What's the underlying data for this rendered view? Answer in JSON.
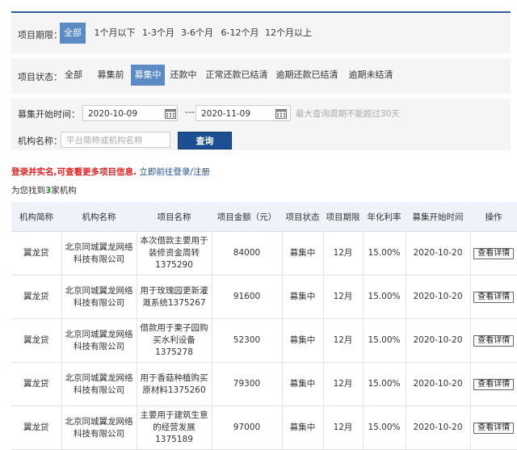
{
  "filters": {
    "term": {
      "label": "项目期限：",
      "options": [
        "全部",
        "1个月以下",
        "1-3个月",
        "3-6个月",
        "6-12个月",
        "12个月以上"
      ],
      "active_index": 0
    },
    "status": {
      "label": "项目状态：",
      "options": [
        "全部",
        "募集前",
        "募集中",
        "还款中",
        "正常还款已结清",
        "逾期还款已结清",
        "逾期未结清"
      ],
      "active_index": 2
    },
    "date": {
      "label": "募集开始时间：",
      "start": "2020-10-09",
      "separator": "---",
      "end": "2020-11-09",
      "hint": "最大查询周期不能超过30天"
    },
    "org": {
      "label": "机构名称：",
      "placeholder": "平台简称或机构名称",
      "query_label": "查询"
    }
  },
  "notice": {
    "warning": "登录并实名,可查看更多项目信息.",
    "link": "立即前往登录/注册"
  },
  "found": {
    "prefix": "为您找到",
    "count": "3",
    "suffix": "家机构"
  },
  "table": {
    "headers": [
      "机构简称",
      "机构名称",
      "项目名称",
      "项目金额（元）",
      "项目状态",
      "项目期限",
      "年化利率",
      "募集开始时间",
      "操作"
    ],
    "rows": [
      {
        "short": "翼龙贷",
        "org": "北京同城翼龙网络科技有限公司",
        "project": "本次借款主要用于装修资金周转1375290",
        "amount": "84000",
        "status": "募集中",
        "term": "12月",
        "rate": "15.00%",
        "start": "2020-10-20",
        "action": "查看详情"
      },
      {
        "short": "翼龙贷",
        "org": "北京同城翼龙网络科技有限公司",
        "project": "用于玫瑰园更新灌溉系统1375267",
        "amount": "91600",
        "status": "募集中",
        "term": "12月",
        "rate": "15.00%",
        "start": "2020-10-20",
        "action": "查看详情"
      },
      {
        "short": "翼龙贷",
        "org": "北京同城翼龙网络科技有限公司",
        "project": "借款用于栗子园购买水利设备1375278",
        "amount": "52300",
        "status": "募集中",
        "term": "12月",
        "rate": "15.00%",
        "start": "2020-10-20",
        "action": "查看详情"
      },
      {
        "short": "翼龙贷",
        "org": "北京同城翼龙网络科技有限公司",
        "project": "用于香菇种植购买原材料1375260",
        "amount": "79300",
        "status": "募集中",
        "term": "12月",
        "rate": "15.00%",
        "start": "2020-10-20",
        "action": "查看详情"
      },
      {
        "short": "翼龙贷",
        "org": "北京同城翼龙网络科技有限公司",
        "project": "主要用于建筑生意的经营发展1375189",
        "amount": "97000",
        "status": "募集中",
        "term": "12月",
        "rate": "15.00%",
        "start": "2020-10-20",
        "action": "查看详情"
      }
    ]
  }
}
